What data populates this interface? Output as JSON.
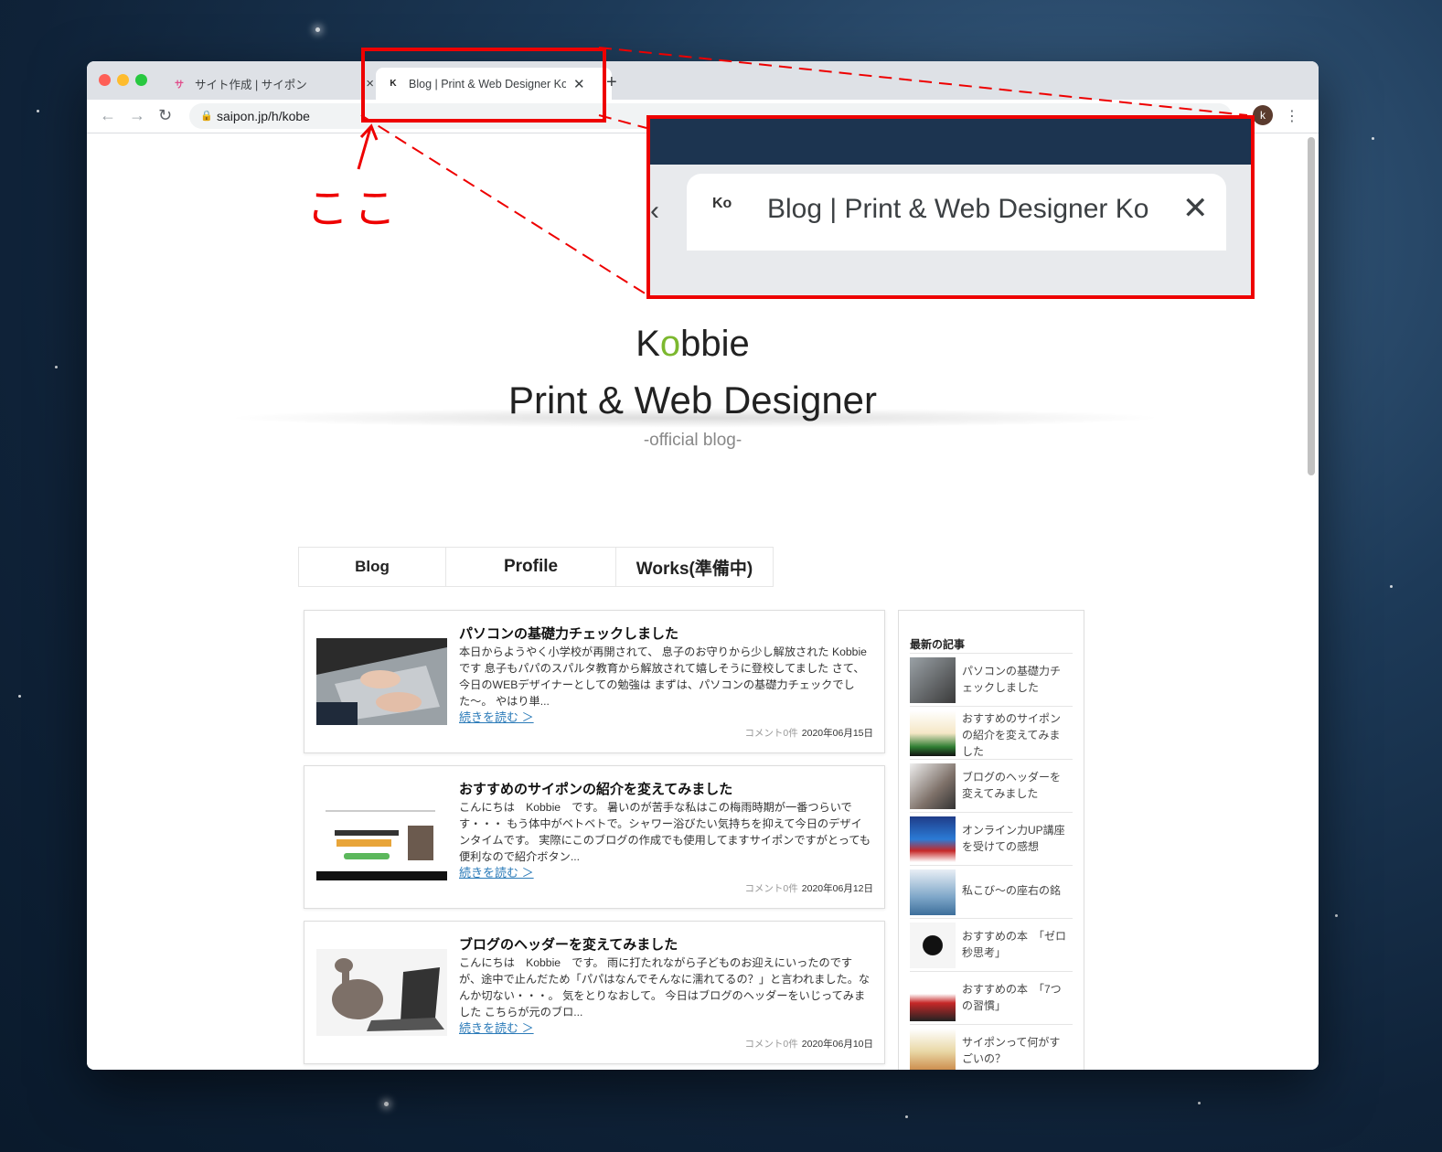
{
  "browser": {
    "tabs": [
      {
        "title": "サイト作成 | サイポン",
        "active": false
      },
      {
        "title": "Blog | Print & Web Designer Ko",
        "active": true
      }
    ],
    "url": "saipon.jp/h/kobe",
    "avatar_letter": "k"
  },
  "header": {
    "brand_prefix": "K",
    "brand_o": "o",
    "brand_suffix": "bbie",
    "subtitle": "Print & Web Designer",
    "tagline": "-official blog-"
  },
  "nav": {
    "items": [
      "Blog",
      "Profile",
      "Works(準備中)"
    ]
  },
  "posts": [
    {
      "title": "パソコンの基礎力チェックしました",
      "excerpt": "本日からようやく小学校が再開されて、 息子のお守りから少し解放された Kobbie です 息子もパパのスパルタ教育から解放されて嬉しそうに登校してました さて、今日のWEBデザイナーとしての勉強は まずは、パソコンの基礎力チェックでした〜。 やはり単...",
      "more": "続きを読む ＞",
      "comments": "コメント0件",
      "date": "2020年06月15日"
    },
    {
      "title": "おすすめのサイポンの紹介を変えてみました",
      "excerpt": "こんにちは　Kobbie　です。 暑いのが苦手な私はこの梅雨時期が一番つらいです・・・ もう体中がベトベトで。シャワー浴びたい気持ちを抑えて今日のデザインタイムです。 実際にこのブログの作成でも使用してますサイポンですがとっても便利なので紹介ボタン...",
      "more": "続きを読む ＞",
      "comments": "コメント0件",
      "date": "2020年06月12日"
    },
    {
      "title": "ブログのヘッダーを変えてみました",
      "excerpt": "こんにちは　Kobbie　です。 雨に打たれながら子どものお迎えにいったのですが、途中で止んだため「パパはなんでそんなに濡れてるの？」と言われました。なんか切ない・・・。 気をとりなおして。 今日はブログのヘッダーをいじってみました こちらが元のブロ...",
      "more": "続きを読む ＞",
      "comments": "コメント0件",
      "date": "2020年06月10日"
    }
  ],
  "sidebar": {
    "heading": "最新の記事",
    "items": [
      "パソコンの基礎力チェックしました",
      "おすすめのサイポンの紹介を変えてみました",
      "ブログのヘッダーを変えてみました",
      "オンライン力UP講座を受けての感想",
      "私こび〜の座右の銘",
      "おすすめの本　「ゼロ秒思考」",
      "おすすめの本　「7つの習慣」",
      "サイポンって何がすごいの？"
    ]
  },
  "annotation": {
    "zoom_title": "Blog | Print & Web Designer Ko",
    "handwritten": "ここ",
    "color": "#e00000"
  }
}
